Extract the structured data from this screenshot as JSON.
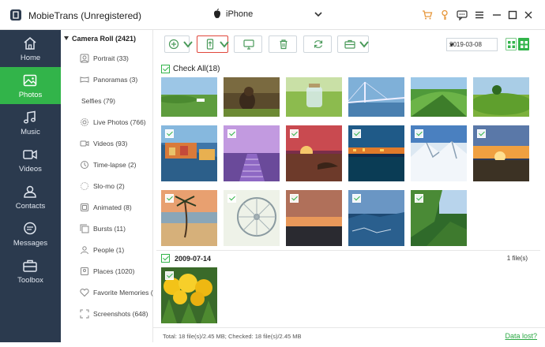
{
  "app": {
    "title": "MobieTrans (Unregistered)"
  },
  "device": {
    "name": "iPhone"
  },
  "nav": [
    {
      "label": "Home",
      "icon": "home-icon"
    },
    {
      "label": "Photos",
      "icon": "photo-icon",
      "active": true
    },
    {
      "label": "Music",
      "icon": "music-icon"
    },
    {
      "label": "Videos",
      "icon": "video-icon"
    },
    {
      "label": "Contacts",
      "icon": "contacts-icon"
    },
    {
      "label": "Messages",
      "icon": "messages-icon"
    },
    {
      "label": "Toolbox",
      "icon": "toolbox-icon"
    }
  ],
  "albums": {
    "header": "Camera Roll (2421)",
    "items": [
      {
        "label": "Portrait (33)"
      },
      {
        "label": "Panoramas (3)"
      },
      {
        "label": "Selfies (79)"
      },
      {
        "label": "Live Photos (766)"
      },
      {
        "label": "Videos (93)"
      },
      {
        "label": "Time-lapse (2)"
      },
      {
        "label": "Slo-mo (2)"
      },
      {
        "label": "Animated (8)"
      },
      {
        "label": "Bursts (11)"
      },
      {
        "label": "People (1)"
      },
      {
        "label": "Places (1020)"
      },
      {
        "label": "Favorite Memories (..."
      },
      {
        "label": "Screenshots (648)"
      }
    ]
  },
  "toolbar": {
    "date_value": "2019-03-08"
  },
  "main": {
    "check_all_label": "Check All(18)",
    "group_date": "2009-07-14",
    "group_count": "1 file(s)",
    "status": "Total: 18 file(s)/2.45 MB; Checked: 18 file(s)/2.45 MB",
    "data_lost": "Data lost?"
  },
  "colors": {
    "accent": "#32b44a",
    "nav_bg": "#2b3a4e",
    "highlight_border": "#e0473c",
    "title_icon_orange": "#e6963a"
  }
}
